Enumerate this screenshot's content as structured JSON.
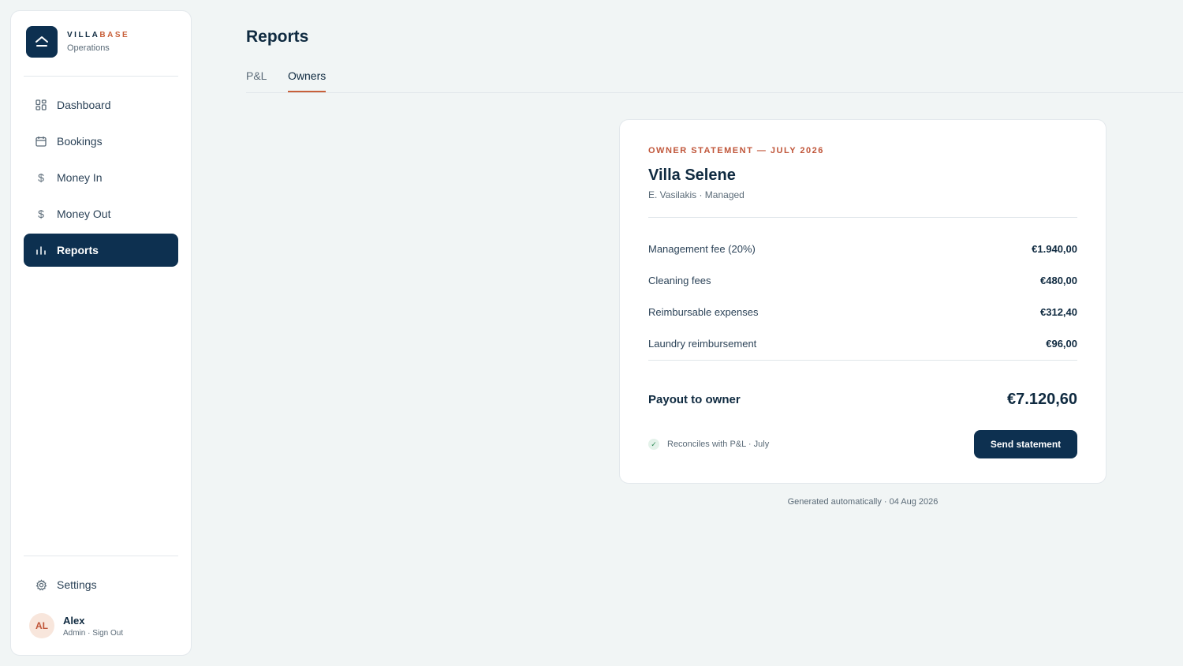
{
  "brand": {
    "name_part1": "VILLA",
    "name_part2": "BASE",
    "subtitle": "Operations",
    "accent_color": "#c8603a",
    "logo_icon": "house-roof-icon"
  },
  "sidebar": {
    "items": [
      {
        "label": "Dashboard",
        "icon": "grid-icon",
        "active": false
      },
      {
        "label": "Bookings",
        "icon": "calendar-icon",
        "active": false
      },
      {
        "label": "Money In",
        "icon": "dollar-icon",
        "active": false
      },
      {
        "label": "Money Out",
        "icon": "dollar-icon",
        "active": false
      },
      {
        "label": "Reports",
        "icon": "bar-chart-icon",
        "active": true
      }
    ],
    "settings_label": "Settings",
    "user": {
      "initials": "AL",
      "name": "Alex",
      "meta": "Admin · Sign Out"
    },
    "active_color": "#0d3050"
  },
  "page": {
    "title": "Reports",
    "tabs": [
      {
        "label": "P&L",
        "active": false
      },
      {
        "label": "Owners",
        "active": true
      }
    ]
  },
  "statement": {
    "eyebrow": "OWNER STATEMENT — JULY 2026",
    "villa_name": "Villa Selene",
    "owner_meta": "E. Vasilakis · Managed",
    "lines": [
      {
        "label": "Management fee (20%)",
        "amount": "€1.940,00"
      },
      {
        "label": "Cleaning fees",
        "amount": "€480,00"
      },
      {
        "label": "Reimbursable expenses",
        "amount": "€312,40"
      },
      {
        "label": "Laundry reimbursement",
        "amount": "€96,00"
      }
    ],
    "payout_label": "Payout to owner",
    "payout_amount": "€7.120,60",
    "reconcile_text": "Reconciles with P&L · July",
    "send_button": "Send statement",
    "footnote": "Generated automatically · 04 Aug 2026"
  }
}
